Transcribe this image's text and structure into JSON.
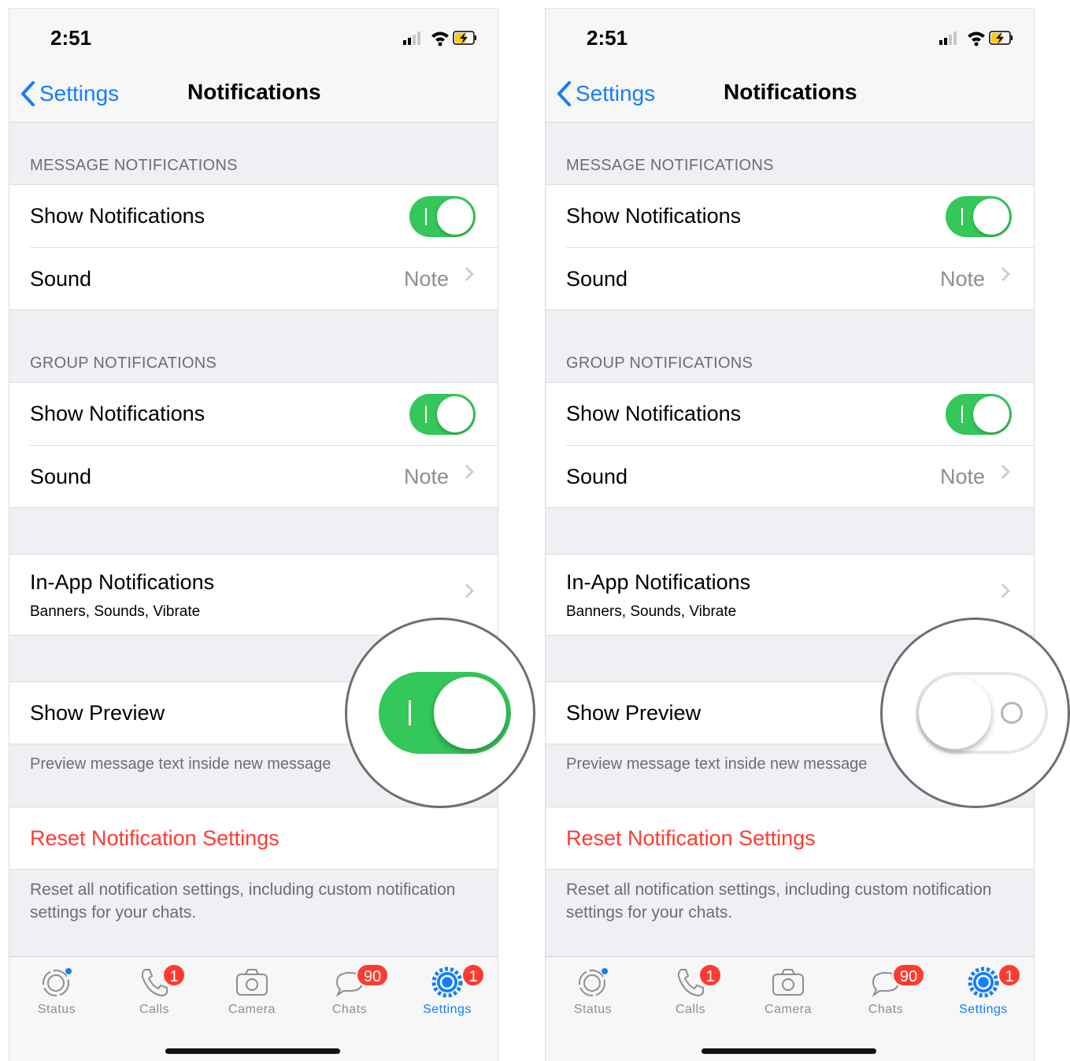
{
  "screens": [
    {
      "status_time": "2:51",
      "nav": {
        "back_label": "Settings",
        "title": "Notifications"
      },
      "message_section": {
        "header": "MESSAGE NOTIFICATIONS",
        "show_label": "Show Notifications",
        "show_on": true,
        "sound_label": "Sound",
        "sound_value": "Note"
      },
      "group_section": {
        "header": "GROUP NOTIFICATIONS",
        "show_label": "Show Notifications",
        "show_on": true,
        "sound_label": "Sound",
        "sound_value": "Note"
      },
      "in_app": {
        "label": "In-App Notifications",
        "sub": "Banners, Sounds, Vibrate"
      },
      "preview": {
        "label": "Show Preview",
        "on": true,
        "footer": "Preview message text inside new message"
      },
      "reset": {
        "label": "Reset Notification Settings",
        "footer": "Reset all notification settings, including custom notification settings for your chats."
      },
      "tabs": [
        {
          "label": "Status",
          "icon": "status-icon",
          "badge": ""
        },
        {
          "label": "Calls",
          "icon": "calls-icon",
          "badge": "1"
        },
        {
          "label": "Camera",
          "icon": "camera-icon",
          "badge": ""
        },
        {
          "label": "Chats",
          "icon": "chats-icon",
          "badge": "90"
        },
        {
          "label": "Settings",
          "icon": "settings-icon",
          "badge": "1",
          "active": true
        }
      ]
    },
    {
      "status_time": "2:51",
      "nav": {
        "back_label": "Settings",
        "title": "Notifications"
      },
      "message_section": {
        "header": "MESSAGE NOTIFICATIONS",
        "show_label": "Show Notifications",
        "show_on": true,
        "sound_label": "Sound",
        "sound_value": "Note"
      },
      "group_section": {
        "header": "GROUP NOTIFICATIONS",
        "show_label": "Show Notifications",
        "show_on": true,
        "sound_label": "Sound",
        "sound_value": "Note"
      },
      "in_app": {
        "label": "In-App Notifications",
        "sub": "Banners, Sounds, Vibrate"
      },
      "preview": {
        "label": "Show Preview",
        "on": false,
        "footer": "Preview message text inside new message"
      },
      "reset": {
        "label": "Reset Notification Settings",
        "footer": "Reset all notification settings, including custom notification settings for your chats."
      },
      "tabs": [
        {
          "label": "Status",
          "icon": "status-icon",
          "badge": ""
        },
        {
          "label": "Calls",
          "icon": "calls-icon",
          "badge": "1"
        },
        {
          "label": "Camera",
          "icon": "camera-icon",
          "badge": ""
        },
        {
          "label": "Chats",
          "icon": "chats-icon",
          "badge": "90"
        },
        {
          "label": "Settings",
          "icon": "settings-icon",
          "badge": "1",
          "active": true
        }
      ]
    }
  ],
  "colors": {
    "accent": "#147efb",
    "toggle_on": "#34c759",
    "destructive": "#ff3b30",
    "badge": "#ff3b30"
  }
}
